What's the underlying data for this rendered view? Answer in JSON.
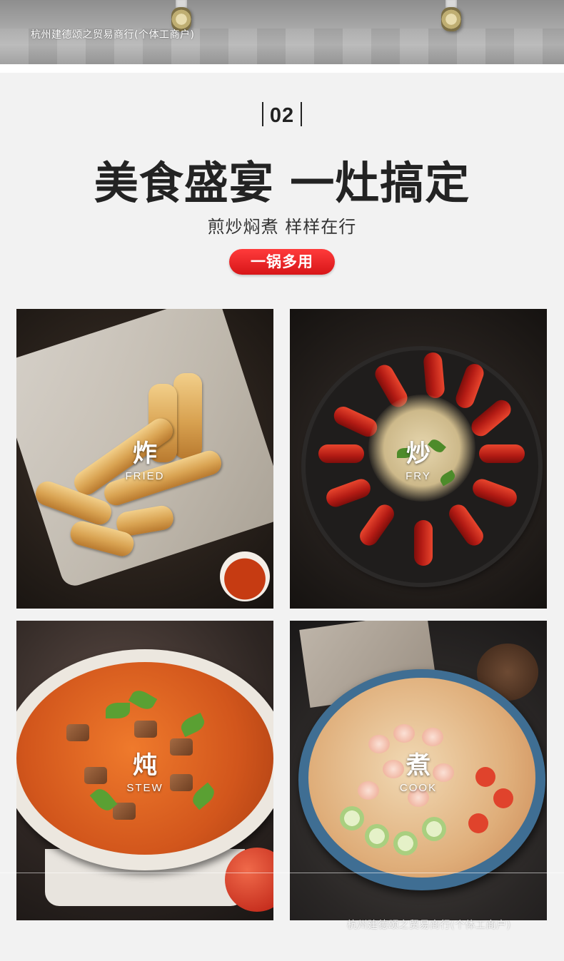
{
  "banner": {
    "shop_name": "杭州建德颂之贸易商行(个体工商户)"
  },
  "section": {
    "number": "02",
    "headline": "美食盛宴 一灶搞定",
    "subline": "煎炒焖煮 样样在行",
    "badge": "一锅多用"
  },
  "cards": [
    {
      "cn": "炸",
      "en": "FRIED"
    },
    {
      "cn": "炒",
      "en": "FRY"
    },
    {
      "cn": "炖",
      "en": "STEW"
    },
    {
      "cn": "煮",
      "en": "COOK"
    }
  ],
  "footer": {
    "shop_name": "杭州建德颂之贸易商行(个体工商户)"
  },
  "colors": {
    "section_bg": "#f2f2f2",
    "headline": "#232323",
    "badge_red": "#d71518",
    "badge_text": "#ffffff"
  }
}
